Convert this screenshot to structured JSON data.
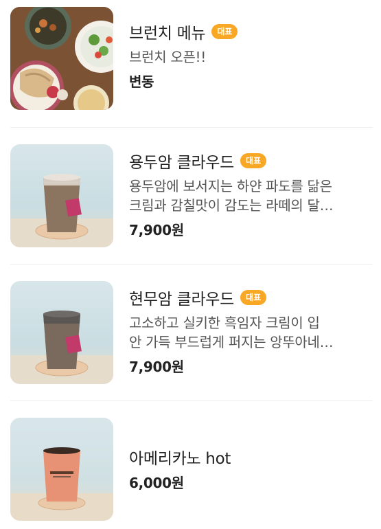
{
  "menu": {
    "items": [
      {
        "title": "브런치 메뉴",
        "badge": "대표",
        "description_lines": [
          "브런치 오픈!!"
        ],
        "price": "변동"
      },
      {
        "title": "용두암 클라우드",
        "badge": "대표",
        "description_lines": [
          "용두암에 보서지는 하얀 파도를 닮은",
          "크림과 감칠맛이 감도는 라떼의 달…"
        ],
        "price": "7,900원"
      },
      {
        "title": "현무암 클라우드",
        "badge": "대표",
        "description_lines": [
          "고소하고 실키한 흑임자 크림이 입",
          "안 가득 부드럽게 퍼지는 앙뚜아네…"
        ],
        "price": "7,900원"
      },
      {
        "title": "아메리카노 hot",
        "price": "6,000원"
      }
    ]
  },
  "colors": {
    "badge": "#f9a825",
    "divider": "#eeeeee",
    "text": "#222222",
    "description": "#555555"
  },
  "icons": {
    "item1": "brunch-plates-photo",
    "item2": "cream-latte-cup-photo",
    "item3": "black-sesame-latte-cup-photo",
    "item4": "hot-americano-cup-photo"
  }
}
